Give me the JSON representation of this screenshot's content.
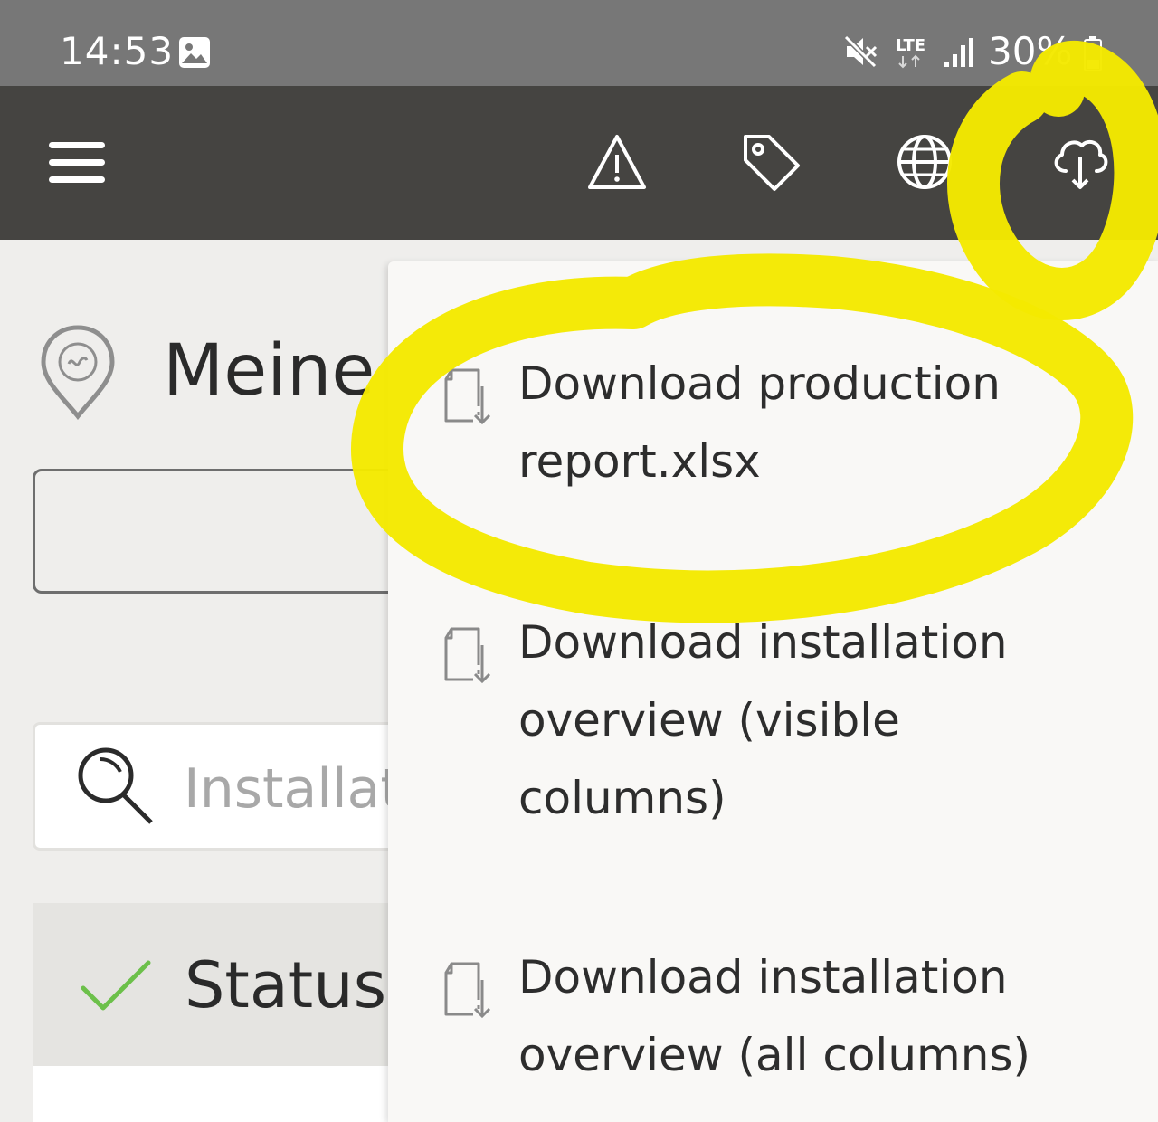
{
  "status_bar": {
    "time": "14:53",
    "network": "LTE",
    "battery": "30%"
  },
  "app_bar": {
    "icons": [
      "menu-icon",
      "alert-icon",
      "tag-icon",
      "globe-icon",
      "cloud-download-icon"
    ]
  },
  "page": {
    "title": "Meine",
    "search_placeholder": "Installati",
    "status_label": "Status"
  },
  "dropdown": {
    "items": [
      {
        "label": "Download production report.xlsx",
        "icon": "file-download-icon"
      },
      {
        "label": "Download installation overview (visible columns)",
        "icon": "file-download-icon"
      },
      {
        "label": "Download installation overview (all columns)",
        "icon": "file-download-icon"
      }
    ]
  },
  "colors": {
    "status_bar": "#777777",
    "app_bar": "#454441",
    "background": "#efeeec",
    "dropdown": "#f9f8f6",
    "check": "#6cc04a",
    "highlight": "#f4e900"
  }
}
